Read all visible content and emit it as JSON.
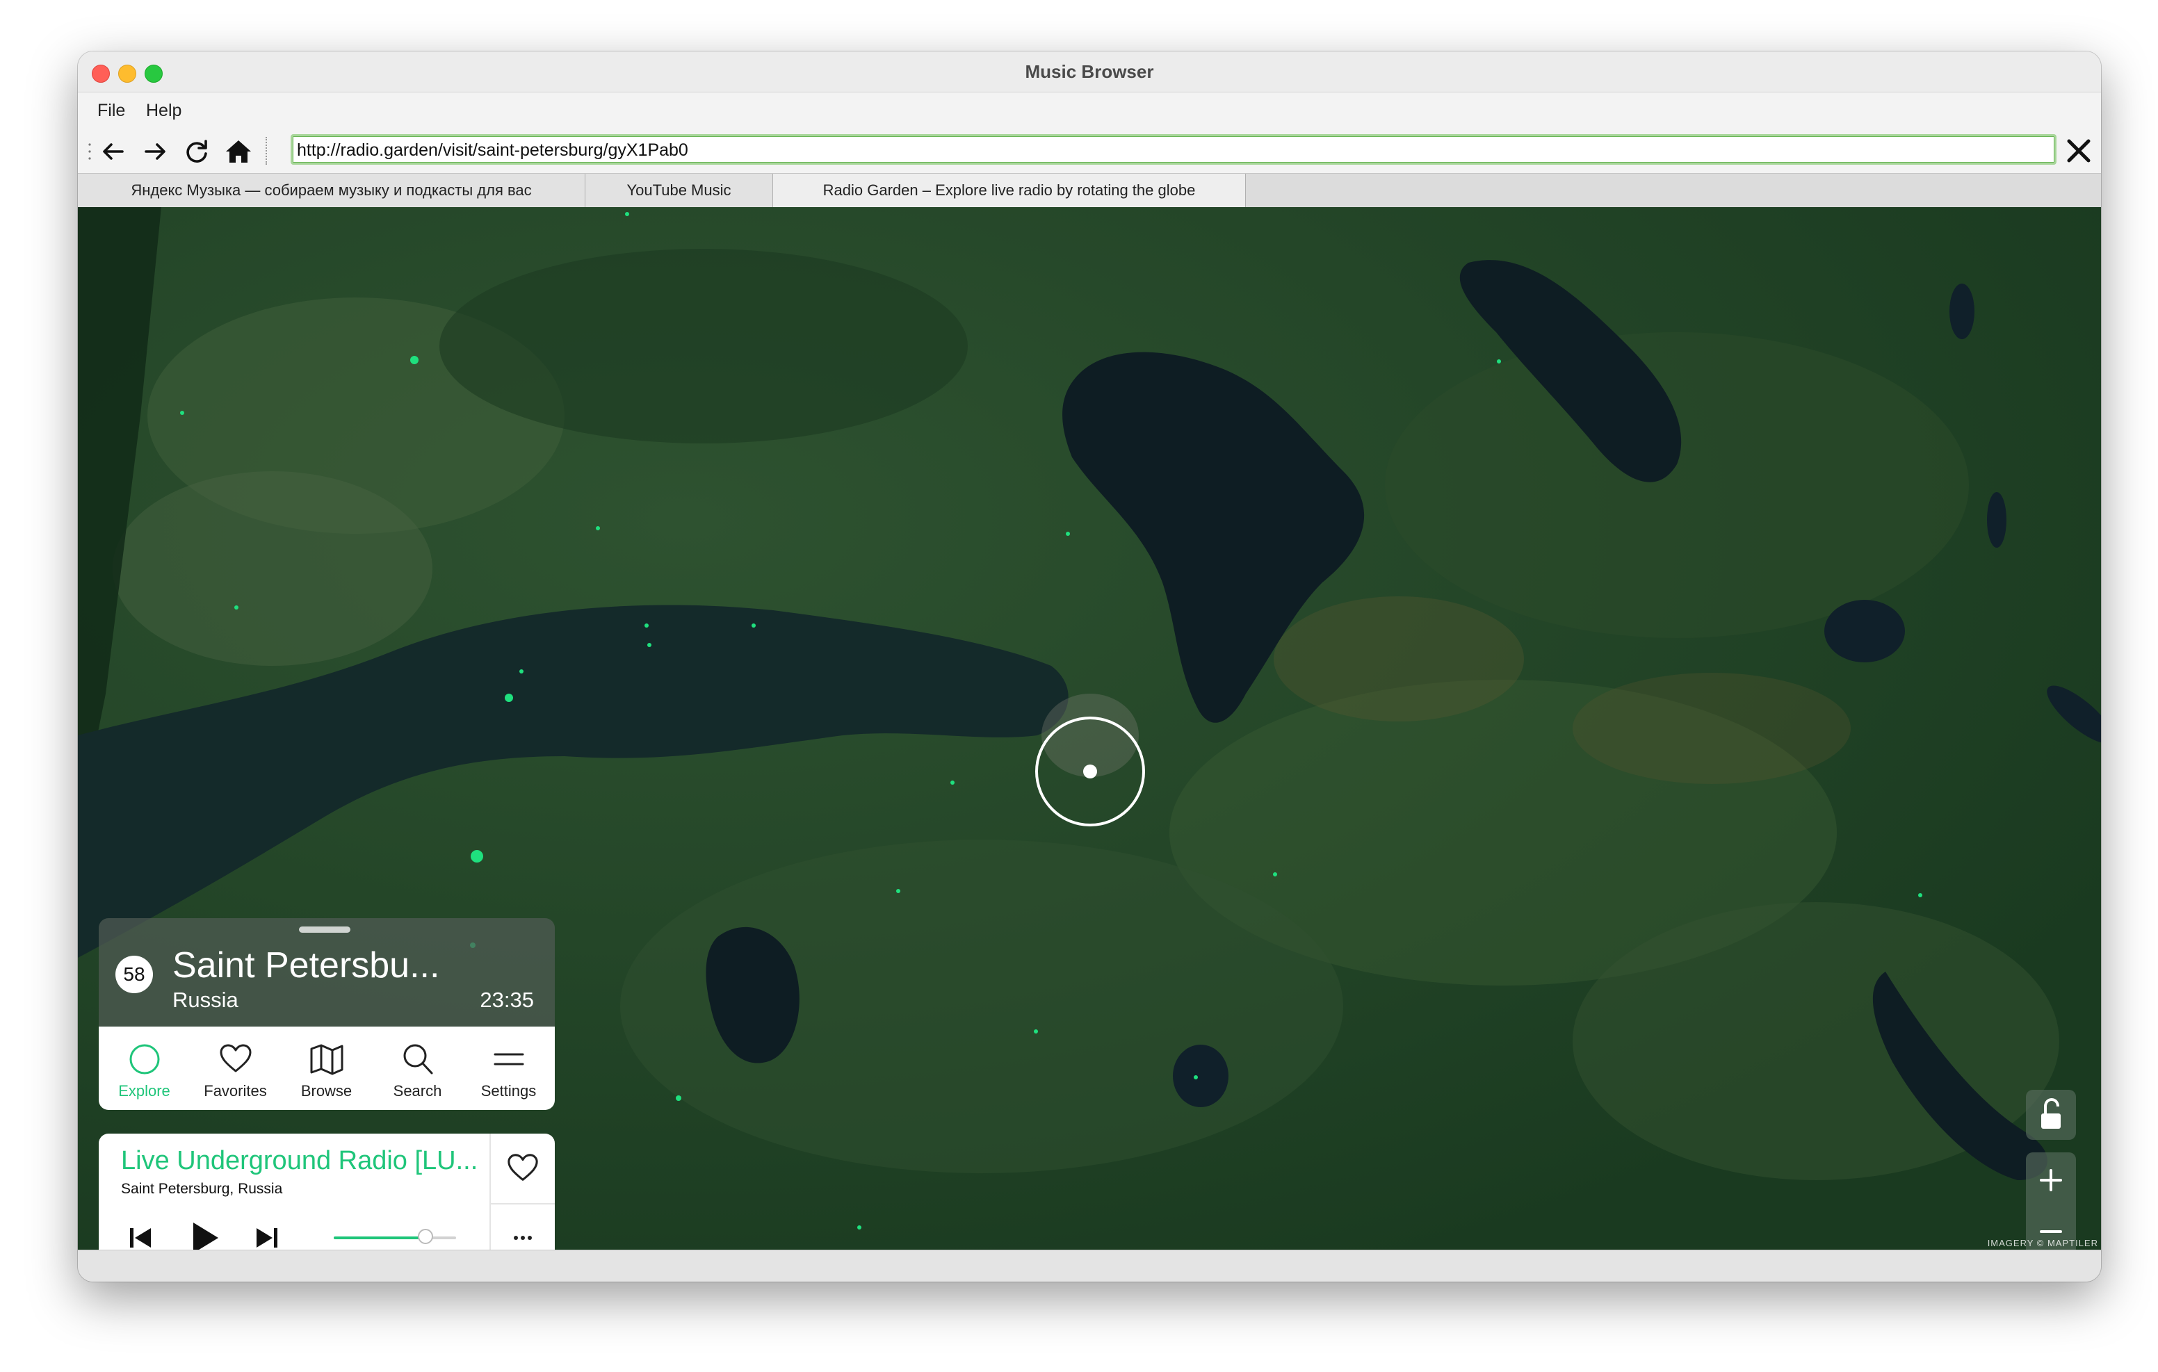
{
  "window": {
    "title": "Music Browser"
  },
  "menu": [
    "File",
    "Help"
  ],
  "toolbar": {
    "url": "http://radio.garden/visit/saint-petersburg/gyX1Pab0",
    "back_icon": "arrow-left-icon",
    "forward_icon": "arrow-right-icon",
    "reload_icon": "reload-icon",
    "home_icon": "home-icon",
    "close_icon": "close-icon"
  },
  "tabs": [
    {
      "label": "Яндекс Музыка — собираем музыку и подкасты для вас",
      "active": false
    },
    {
      "label": "YouTube Music",
      "active": false
    },
    {
      "label": "Radio Garden – Explore live radio by rotating the globe",
      "active": true
    }
  ],
  "city_card": {
    "station_count": "58",
    "city": "Saint Petersbu...",
    "country": "Russia",
    "local_time": "23:35"
  },
  "nav": [
    {
      "label": "Explore",
      "icon": "explore-circle-icon",
      "active": true
    },
    {
      "label": "Favorites",
      "icon": "heart-icon",
      "active": false
    },
    {
      "label": "Browse",
      "icon": "map-icon",
      "active": false
    },
    {
      "label": "Search",
      "icon": "search-icon",
      "active": false
    },
    {
      "label": "Settings",
      "icon": "menu-icon",
      "active": false
    }
  ],
  "player": {
    "station": "Live Underground Radio [LU...",
    "location": "Saint Petersburg, Russia",
    "volume": 0.75
  },
  "map": {
    "attribution": "IMAGERY © MAPTILER",
    "accent_color": "#1fc57a"
  }
}
